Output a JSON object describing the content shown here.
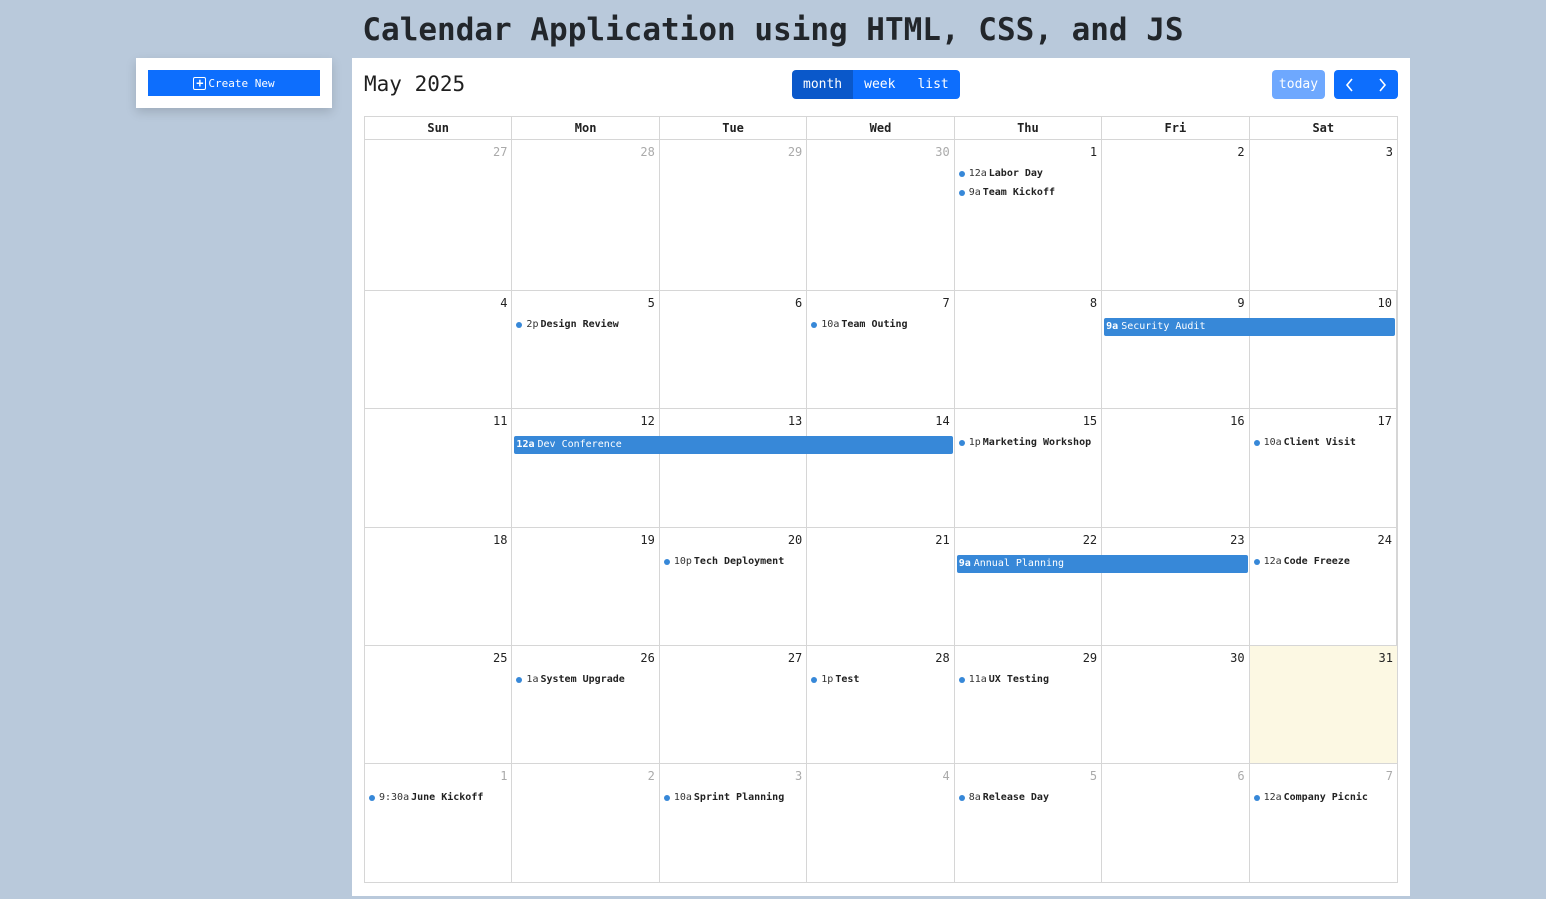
{
  "page_title": "Calendar Application using HTML, CSS, and JS",
  "sidebar": {
    "create_label": "Create New"
  },
  "calendar": {
    "title": "May 2025",
    "views": [
      "month",
      "week",
      "list"
    ],
    "active_view": "month",
    "today_label": "today",
    "weekdays": [
      "Sun",
      "Mon",
      "Tue",
      "Wed",
      "Thu",
      "Fri",
      "Sat"
    ],
    "weeks": [
      {
        "days": [
          {
            "num": "27",
            "other": true,
            "events": []
          },
          {
            "num": "28",
            "other": true,
            "events": []
          },
          {
            "num": "29",
            "other": true,
            "events": []
          },
          {
            "num": "30",
            "other": true,
            "events": []
          },
          {
            "num": "1",
            "events": [
              {
                "time": "12a",
                "title": "Labor Day"
              },
              {
                "time": "9a",
                "title": "Team Kickoff"
              }
            ]
          },
          {
            "num": "2",
            "events": []
          },
          {
            "num": "3",
            "events": []
          }
        ],
        "bars": []
      },
      {
        "days": [
          {
            "num": "4",
            "events": []
          },
          {
            "num": "5",
            "events": [
              {
                "time": "2p",
                "title": "Design Review"
              }
            ]
          },
          {
            "num": "6",
            "events": []
          },
          {
            "num": "7",
            "events": [
              {
                "time": "10a",
                "title": "Team Outing"
              }
            ]
          },
          {
            "num": "8",
            "events": []
          },
          {
            "num": "9",
            "events": []
          },
          {
            "num": "10",
            "events": []
          }
        ],
        "bars": [
          {
            "start": 5,
            "span": 2,
            "time": "9a",
            "title": "Security Audit"
          }
        ]
      },
      {
        "days": [
          {
            "num": "11",
            "events": []
          },
          {
            "num": "12",
            "events": []
          },
          {
            "num": "13",
            "events": []
          },
          {
            "num": "14",
            "events": []
          },
          {
            "num": "15",
            "events": [
              {
                "time": "1p",
                "title": "Marketing Workshop"
              }
            ]
          },
          {
            "num": "16",
            "events": []
          },
          {
            "num": "17",
            "events": [
              {
                "time": "10a",
                "title": "Client Visit"
              }
            ]
          }
        ],
        "bars": [
          {
            "start": 1,
            "span": 3,
            "time": "12a",
            "title": "Dev Conference"
          }
        ]
      },
      {
        "days": [
          {
            "num": "18",
            "events": []
          },
          {
            "num": "19",
            "events": []
          },
          {
            "num": "20",
            "events": [
              {
                "time": "10p",
                "title": "Tech Deployment"
              }
            ]
          },
          {
            "num": "21",
            "events": []
          },
          {
            "num": "22",
            "events": []
          },
          {
            "num": "23",
            "events": []
          },
          {
            "num": "24",
            "events": [
              {
                "time": "12a",
                "title": "Code Freeze"
              }
            ]
          }
        ],
        "bars": [
          {
            "start": 4,
            "span": 2,
            "time": "9a",
            "title": "Annual Planning"
          }
        ]
      },
      {
        "days": [
          {
            "num": "25",
            "events": []
          },
          {
            "num": "26",
            "events": [
              {
                "time": "1a",
                "title": "System Upgrade"
              }
            ]
          },
          {
            "num": "27",
            "events": []
          },
          {
            "num": "28",
            "events": [
              {
                "time": "1p",
                "title": "Test"
              }
            ]
          },
          {
            "num": "29",
            "events": [
              {
                "time": "11a",
                "title": "UX Testing"
              }
            ]
          },
          {
            "num": "30",
            "events": []
          },
          {
            "num": "31",
            "today": true,
            "events": []
          }
        ],
        "bars": []
      },
      {
        "days": [
          {
            "num": "1",
            "other": true,
            "events": [
              {
                "time": "9:30a",
                "title": "June Kickoff"
              }
            ]
          },
          {
            "num": "2",
            "other": true,
            "events": []
          },
          {
            "num": "3",
            "other": true,
            "events": [
              {
                "time": "10a",
                "title": "Sprint Planning"
              }
            ]
          },
          {
            "num": "4",
            "other": true,
            "events": []
          },
          {
            "num": "5",
            "other": true,
            "events": [
              {
                "time": "8a",
                "title": "Release Day"
              }
            ]
          },
          {
            "num": "6",
            "other": true,
            "events": []
          },
          {
            "num": "7",
            "other": true,
            "events": [
              {
                "time": "12a",
                "title": "Company Picnic"
              }
            ]
          }
        ],
        "bars": []
      }
    ]
  },
  "colors": {
    "event": "#3788d8",
    "primary": "#0d6efd",
    "today_bg": "#fcf8e3",
    "background": "#b9c9db"
  }
}
